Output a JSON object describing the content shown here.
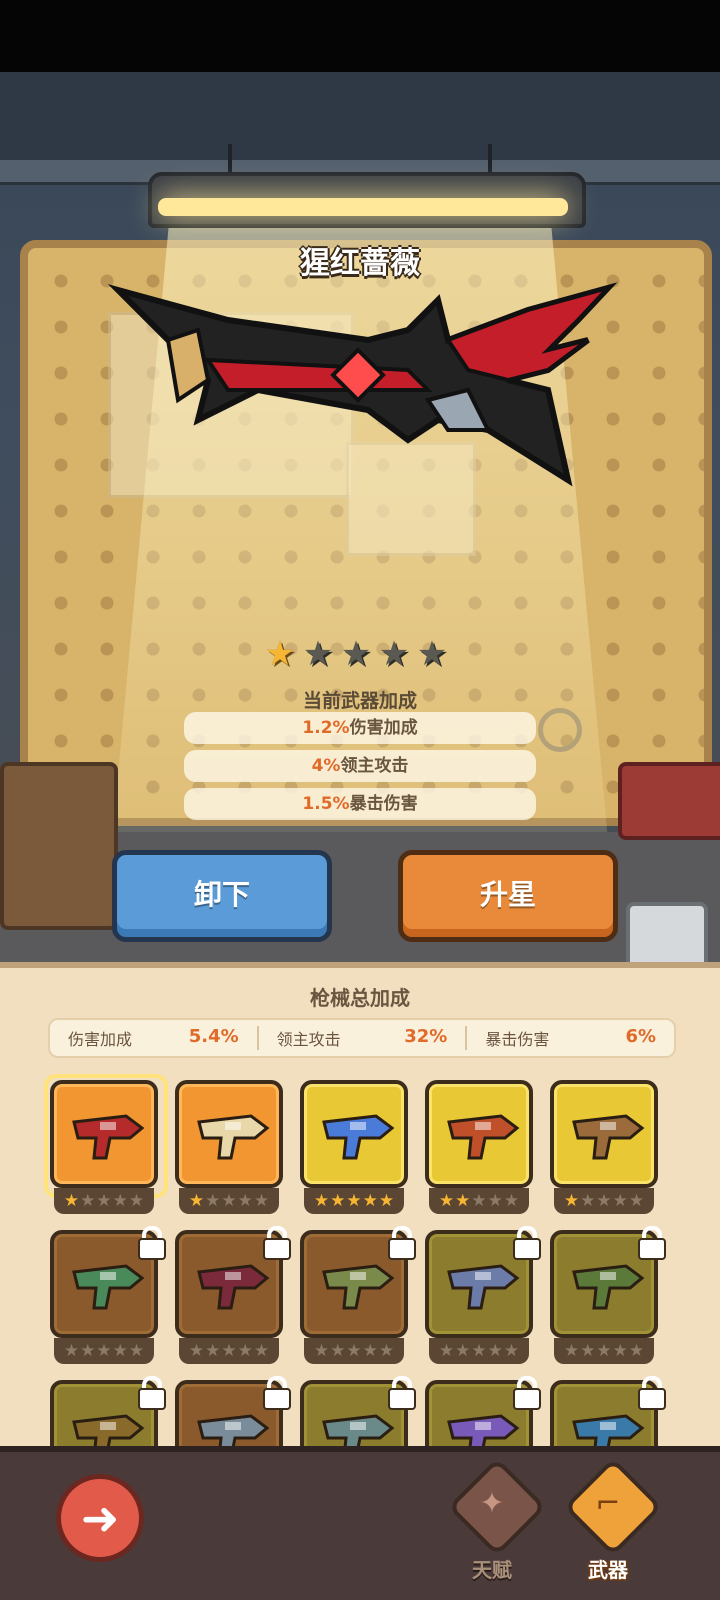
{
  "weapon": {
    "name": "猩红蔷薇",
    "stars": {
      "filled": 1,
      "total": 5
    },
    "bonus_title": "当前武器加成",
    "bonuses": [
      {
        "value": "1.2%",
        "label": "伤害加成"
      },
      {
        "value": "4%",
        "label": "领主攻击"
      },
      {
        "value": "1.5%",
        "label": "暴击伤害"
      }
    ]
  },
  "actions": {
    "unequip_label": "卸下",
    "upgrade_label": "升星"
  },
  "panel": {
    "title": "枪械总加成",
    "summary": [
      {
        "label": "伤害加成",
        "value": "5.4%"
      },
      {
        "label": "领主攻击",
        "value": "32%"
      },
      {
        "label": "暴击伤害",
        "value": "6%"
      }
    ]
  },
  "weapons": [
    {
      "stars": 1,
      "rarity": "orange",
      "locked": false,
      "selected": true,
      "icon": "crimson-rose-gun-icon"
    },
    {
      "stars": 1,
      "rarity": "orange",
      "locked": false,
      "selected": false,
      "icon": "bone-cannon-icon"
    },
    {
      "stars": 5,
      "rarity": "yellow",
      "locked": false,
      "selected": false,
      "icon": "candy-blaster-icon"
    },
    {
      "stars": 2,
      "rarity": "yellow",
      "locked": false,
      "selected": false,
      "icon": "scrap-shotgun-icon"
    },
    {
      "stars": 1,
      "rarity": "yellow",
      "locked": false,
      "selected": false,
      "icon": "teddy-launcher-icon"
    },
    {
      "stars": 0,
      "rarity": "brown",
      "locked": true,
      "selected": false,
      "icon": "dino-gun-icon"
    },
    {
      "stars": 0,
      "rarity": "brown",
      "locked": true,
      "selected": false,
      "icon": "demon-rifle-icon"
    },
    {
      "stars": 0,
      "rarity": "brown",
      "locked": true,
      "selected": false,
      "icon": "drill-gun-icon"
    },
    {
      "stars": 0,
      "rarity": "olive",
      "locked": true,
      "selected": false,
      "icon": "laser-rifle-icon"
    },
    {
      "stars": 0,
      "rarity": "olive",
      "locked": true,
      "selected": false,
      "icon": "bazooka-icon"
    },
    {
      "stars": 0,
      "rarity": "olive",
      "locked": true,
      "selected": false,
      "icon": "dragon-gun-icon"
    },
    {
      "stars": 0,
      "rarity": "brown",
      "locked": true,
      "selected": false,
      "icon": "metal-cannon-icon"
    },
    {
      "stars": 0,
      "rarity": "olive",
      "locked": true,
      "selected": false,
      "icon": "claw-gun-icon"
    },
    {
      "stars": 0,
      "rarity": "olive",
      "locked": true,
      "selected": false,
      "icon": "plasma-gun-icon"
    },
    {
      "stars": 0,
      "rarity": "olive",
      "locked": true,
      "selected": false,
      "icon": "spike-gun-icon"
    }
  ],
  "nav": {
    "back_icon": "back-arrow-icon",
    "talent_label": "天赋",
    "weapon_label": "武器"
  },
  "colors": {
    "accent_orange": "#e06a2a",
    "star_on": "#f6b533",
    "button_blue": "#5a9bd8",
    "button_orange": "#e88a3a"
  }
}
